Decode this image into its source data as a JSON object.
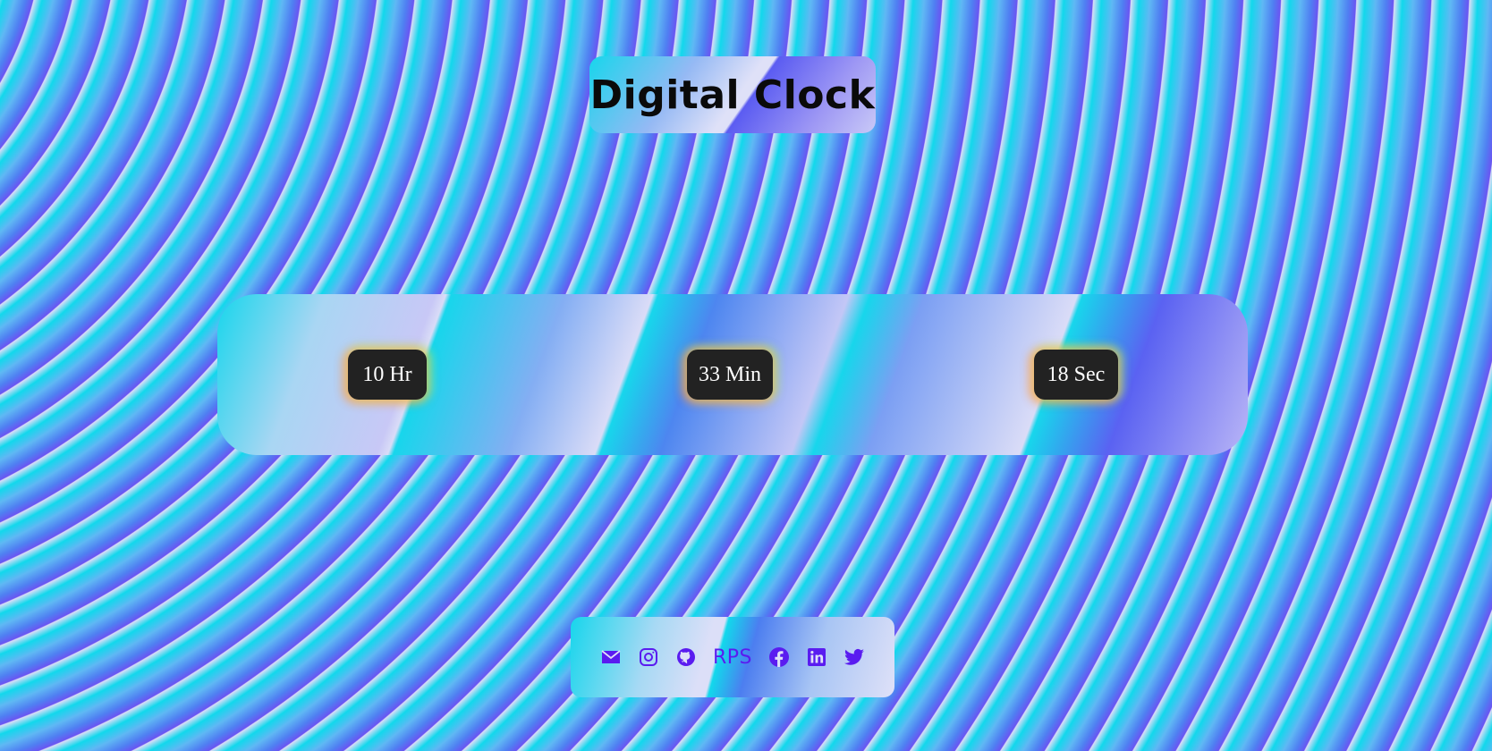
{
  "header": {
    "title": "Digital Clock"
  },
  "clock": {
    "hours": "10 Hr",
    "minutes": "33 Min",
    "seconds": "18 Sec"
  },
  "footer": {
    "links": [
      {
        "name": "mail-icon"
      },
      {
        "name": "instagram-icon"
      },
      {
        "name": "github-icon"
      },
      {
        "label": "RPS"
      },
      {
        "name": "facebook-icon"
      },
      {
        "name": "linkedin-icon"
      },
      {
        "name": "twitter-icon"
      }
    ],
    "icon_color": "#5a1cf0"
  },
  "colors": {
    "cyan": "#12d8ec",
    "blue": "#4f7ff2",
    "violet": "#6a55f2",
    "lavender": "#d9ddf6",
    "chip_bg": "#222222"
  }
}
